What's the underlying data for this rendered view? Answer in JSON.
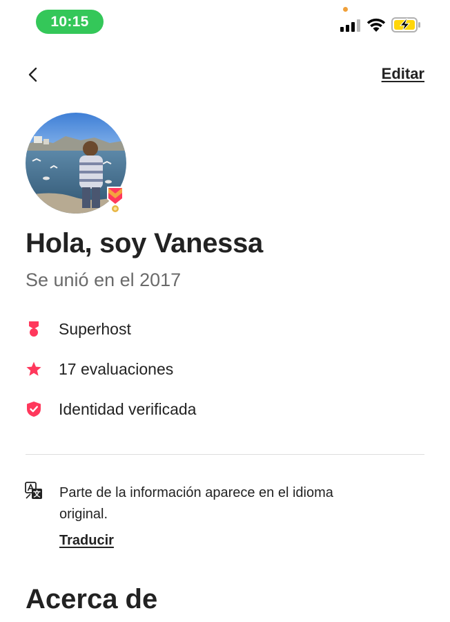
{
  "status_bar": {
    "time": "10:15",
    "signal_icon": "cellular-signal-icon",
    "wifi_icon": "wifi-icon",
    "battery_icon": "battery-charging-icon",
    "time_pill_color": "#34c759",
    "battery_color": "#ffd60a"
  },
  "nav": {
    "back_icon": "chevron-left-icon",
    "edit_label": "Editar"
  },
  "profile": {
    "avatar_icon": "profile-photo",
    "badge_icon": "superhost-medal-icon",
    "greeting": "Hola, soy Vanessa",
    "joined": "Se unió en el 2017"
  },
  "stats": [
    {
      "icon": "superhost-medal-icon",
      "label": "Superhost"
    },
    {
      "icon": "star-icon",
      "label": "17 evaluaciones"
    },
    {
      "icon": "verified-shield-icon",
      "label": "Identidad verificada"
    }
  ],
  "translation": {
    "icon": "translate-icon",
    "notice": "Parte de la información aparece en el idioma original.",
    "link_label": "Traducir"
  },
  "about": {
    "title": "Acerca de"
  },
  "colors": {
    "accent": "#ff385c",
    "text_primary": "#222222",
    "text_secondary": "#6a6a6a",
    "divider": "#dddddd"
  }
}
